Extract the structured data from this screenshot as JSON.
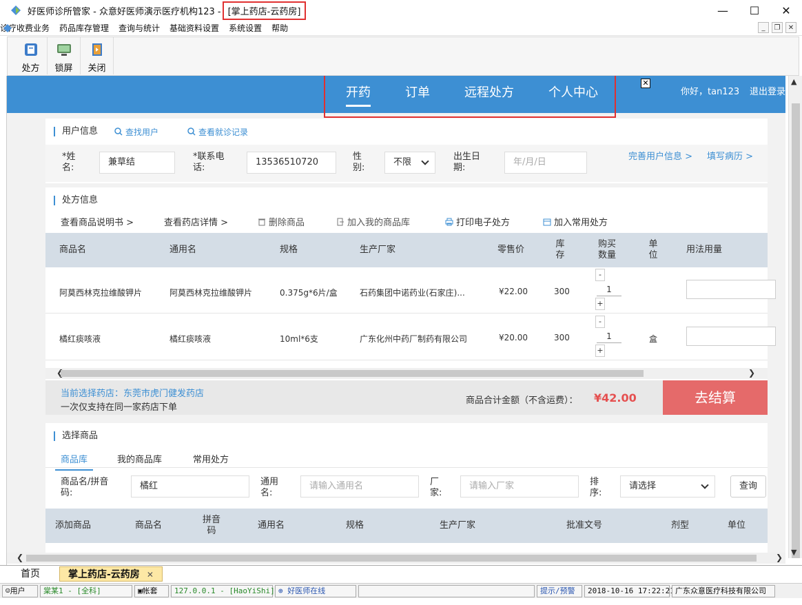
{
  "window": {
    "title": "好医师诊所管家 - 众意好医师演示医疗机构123 -",
    "subtitle": "[掌上药店-云药房]",
    "controls": [
      "—",
      "☐",
      "✕"
    ]
  },
  "menu": [
    "诊疗收费业务",
    "药品库存管理",
    "查询与统计",
    "基础资料设置",
    "系统设置",
    "帮助"
  ],
  "toolbar": [
    {
      "label": "处方",
      "icon": "prescription-icon"
    },
    {
      "label": "锁屏",
      "icon": "lock-screen-icon"
    },
    {
      "label": "关闭",
      "icon": "close-door-icon"
    }
  ],
  "topnav": {
    "items": [
      "开药",
      "订单",
      "远程处方",
      "个人中心"
    ],
    "active": "开药",
    "greeting": "你好，tan123",
    "logout": "退出登录"
  },
  "user_info": {
    "title": "用户信息",
    "find_user": "查找用户",
    "view_records": "查看就诊记录",
    "name_label": "*姓\n名:",
    "name_value": "兼草结",
    "phone_label": "*联系电\n话:",
    "phone_value": "13536510720",
    "gender_label": "性\n别:",
    "gender_value": "不限",
    "birth_label": "出生日\n期:",
    "birth_placeholder": "年/月/日",
    "complete_info": "完善用户信息 >",
    "fill_record": "填写病历 >"
  },
  "prescription": {
    "title": "处方信息",
    "actions": [
      "查看商品说明书 >",
      "查看药店详情 >",
      "删除商品",
      "加入我的商品库",
      "打印电子处方",
      "加入常用处方"
    ],
    "columns": [
      "商品名",
      "通用名",
      "规格",
      "生产厂家",
      "零售价",
      "库存",
      "购买数量",
      "单位",
      "用法用量"
    ],
    "rows": [
      {
        "name": "阿莫西林克拉维酸钾片",
        "generic": "阿莫西林克拉维酸钾片",
        "spec": "0.375g*6片/盒",
        "maker": "石药集团中诺药业(石家庄)...",
        "price": "¥22.00",
        "stock": "300",
        "qty": "1",
        "unit": ""
      },
      {
        "name": "橘红痰咳液",
        "generic": "橘红痰咳液",
        "spec": "10ml*6支",
        "maker": "广东化州中药厂制药有限公司",
        "price": "¥20.00",
        "stock": "300",
        "qty": "1",
        "unit": "盒"
      }
    ]
  },
  "summary": {
    "store": "当前选择药店：东莞市虎门健发药店",
    "note": "一次仅支持在同一家药店下单",
    "total_label": "商品合计金额（不含运费）：",
    "total_value": "¥42.00",
    "checkout": "去结算"
  },
  "select_goods": {
    "title": "选择商品",
    "tabs": [
      "商品库",
      "我的商品库",
      "常用处方"
    ],
    "active_tab": "商品库",
    "name_label": "商品名/拼音\n码:",
    "name_value": "橘红",
    "generic_label": "通用\n名:",
    "generic_placeholder": "请输入通用名",
    "maker_label": "厂\n家:",
    "maker_placeholder": "请输入厂家",
    "sort_label": "排\n序:",
    "sort_value": "请选择",
    "query": "查询",
    "columns": [
      "添加商品",
      "商品名",
      "拼音码",
      "通用名",
      "规格",
      "生产厂家",
      "批准文号",
      "剂型",
      "单位"
    ]
  },
  "tabs": [
    "首页",
    "掌上药店-云药房"
  ],
  "status": {
    "user": "用户",
    "dept": "棠某1 - [全科]",
    "account": "帐套",
    "server": "127.0.0.1 - [HaoYiShi]",
    "online": "好医师在线",
    "alert": "提示/预警",
    "time": "2018-10-16 17:22:21",
    "company": "广东众意医疗科技有限公司"
  }
}
